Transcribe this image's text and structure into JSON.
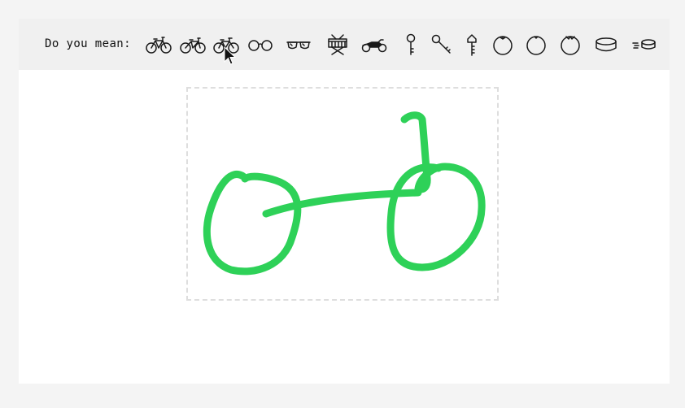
{
  "suggestions": {
    "prompt": "Do you mean:",
    "items": [
      {
        "name": "bicycle-icon"
      },
      {
        "name": "bicycle-icon"
      },
      {
        "name": "bicycle-icon"
      },
      {
        "name": "eyeglasses-icon"
      },
      {
        "name": "sunglasses-icon"
      },
      {
        "name": "drum-icon"
      },
      {
        "name": "motorbike-icon"
      },
      {
        "name": "key-icon"
      },
      {
        "name": "key-icon"
      },
      {
        "name": "key-icon"
      },
      {
        "name": "blueberry-icon"
      },
      {
        "name": "blueberry-icon"
      },
      {
        "name": "blueberry-icon"
      },
      {
        "name": "hockey-puck-icon"
      },
      {
        "name": "hockey-puck-icon"
      }
    ]
  },
  "canvas": {
    "stroke_color": "#2ed158"
  },
  "colors": {
    "page_background": "#f4f4f4",
    "suggestion_bar": "#f0f0f0",
    "canvas_border": "#dedede"
  }
}
